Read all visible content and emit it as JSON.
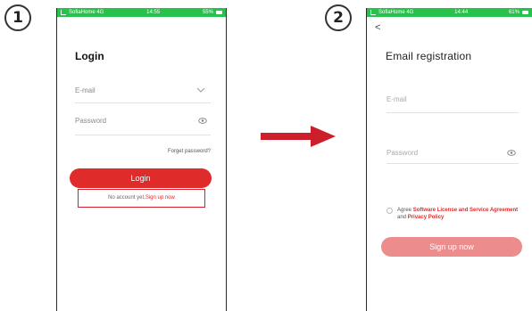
{
  "screen1": {
    "step": "1",
    "status": {
      "carrier": "SofiaHome 4G",
      "time": "14:55",
      "battery": "55%"
    },
    "title": "Login",
    "email_placeholder": "E-mail",
    "password_placeholder": "Password",
    "forgot": "Forget password?",
    "login_button": "Login",
    "no_account": "No account yet,",
    "signup_link": "Sign up now"
  },
  "screen2": {
    "step": "2",
    "status": {
      "carrier": "SofiaHome 4G",
      "time": "14:44",
      "battery": "61%"
    },
    "back": "<",
    "title": "Email registration",
    "email_placeholder": "E-mail",
    "password_placeholder": "Password",
    "agree_prefix": "Agree ",
    "license_link": "Software License and Service Agreement",
    "and_text": "and ",
    "privacy_link": "Privacy Policy",
    "signup_button": "Sign up now"
  },
  "colors": {
    "accent": "#e02b2b",
    "accent_light": "#ec8c8c",
    "status_green": "#27c24c",
    "arrow": "#cc1f2b"
  }
}
